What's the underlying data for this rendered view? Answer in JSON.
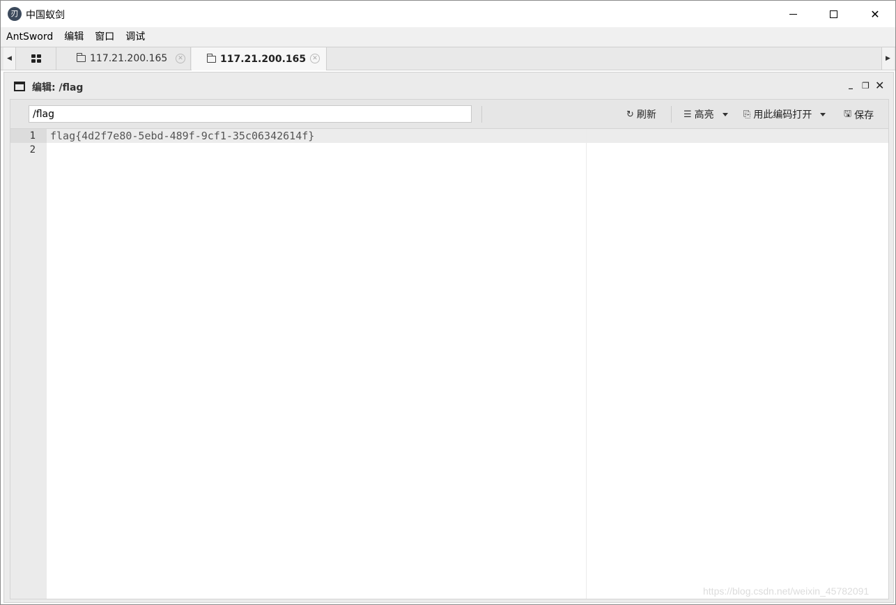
{
  "window": {
    "title": "中国蚁剑",
    "app_icon": "antsword-logo-icon",
    "icon_glyph": "刃"
  },
  "menu": [
    {
      "label": "AntSword"
    },
    {
      "label": "编辑"
    },
    {
      "label": "窗口"
    },
    {
      "label": "调试"
    }
  ],
  "tabs": [
    {
      "label": "117.21.200.165",
      "active": false
    },
    {
      "label": "117.21.200.165",
      "active": true
    }
  ],
  "editor": {
    "title": "编辑: /flag",
    "path_value": "/flag",
    "toolbar": {
      "refresh": "刷新",
      "highlight": "高亮",
      "open_with_encoding": "用此编码打开",
      "save": "保存"
    },
    "lines": [
      {
        "no": "1",
        "text": "flag{4d2f7e80-5ebd-489f-9cf1-35c06342614f}"
      },
      {
        "no": "2",
        "text": ""
      }
    ]
  },
  "watermark": "https://blog.csdn.net/weixin_45782091",
  "colors": {
    "gutter": "#ebebeb",
    "active_line": "#ececec",
    "toolbar": "#e6e6e6"
  }
}
